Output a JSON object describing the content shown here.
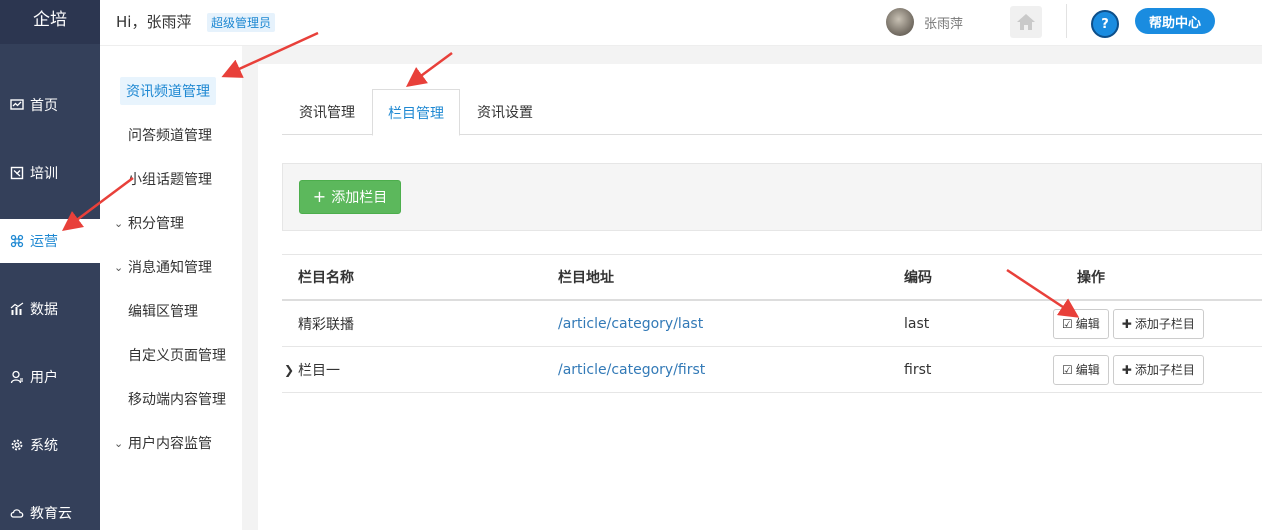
{
  "brand": "企培",
  "header": {
    "greeting": "Hi，张雨萍",
    "role_badge": "超级管理员",
    "username": "张雨萍",
    "help_label": "帮助中心",
    "help_icon": "question-mark-icon",
    "home_icon": "home-icon"
  },
  "leftnav": {
    "items": [
      {
        "label": "首页",
        "icon": "dashboard-icon"
      },
      {
        "label": "培训",
        "icon": "training-icon"
      },
      {
        "label": "运营",
        "icon": "operation-icon",
        "active": true
      },
      {
        "label": "数据",
        "icon": "chart-icon"
      },
      {
        "label": "用户",
        "icon": "user-icon"
      },
      {
        "label": "系统",
        "icon": "gear-icon"
      },
      {
        "label": "教育云",
        "icon": "cloud-icon"
      }
    ]
  },
  "subnav": {
    "items": [
      {
        "label": "资讯频道管理",
        "active": true
      },
      {
        "label": "问答频道管理"
      },
      {
        "label": "小组话题管理"
      },
      {
        "label": "积分管理",
        "group": true
      },
      {
        "label": "消息通知管理",
        "group": true
      },
      {
        "label": "编辑区管理"
      },
      {
        "label": "自定义页面管理"
      },
      {
        "label": "移动端内容管理"
      },
      {
        "label": "用户内容监管",
        "group": true
      }
    ]
  },
  "tabs": [
    {
      "label": "资讯管理"
    },
    {
      "label": "栏目管理",
      "active": true
    },
    {
      "label": "资讯设置"
    }
  ],
  "toolbar": {
    "add_label": "添加栏目"
  },
  "table": {
    "headers": [
      "栏目名称",
      "栏目地址",
      "编码",
      "操作"
    ],
    "rows": [
      {
        "name": "精彩联播",
        "url": "/article/category/last",
        "code": "last",
        "expandable": false
      },
      {
        "name": "栏目一",
        "url": "/article/category/first",
        "code": "first",
        "expandable": true
      }
    ],
    "edit_label": "编辑",
    "add_child_label": "添加子栏目"
  },
  "colors": {
    "nav_bg": "#34405a",
    "accent": "#1e88d2",
    "success": "#5cb85c",
    "link": "#337ab7",
    "annotation": "#e8403a"
  }
}
